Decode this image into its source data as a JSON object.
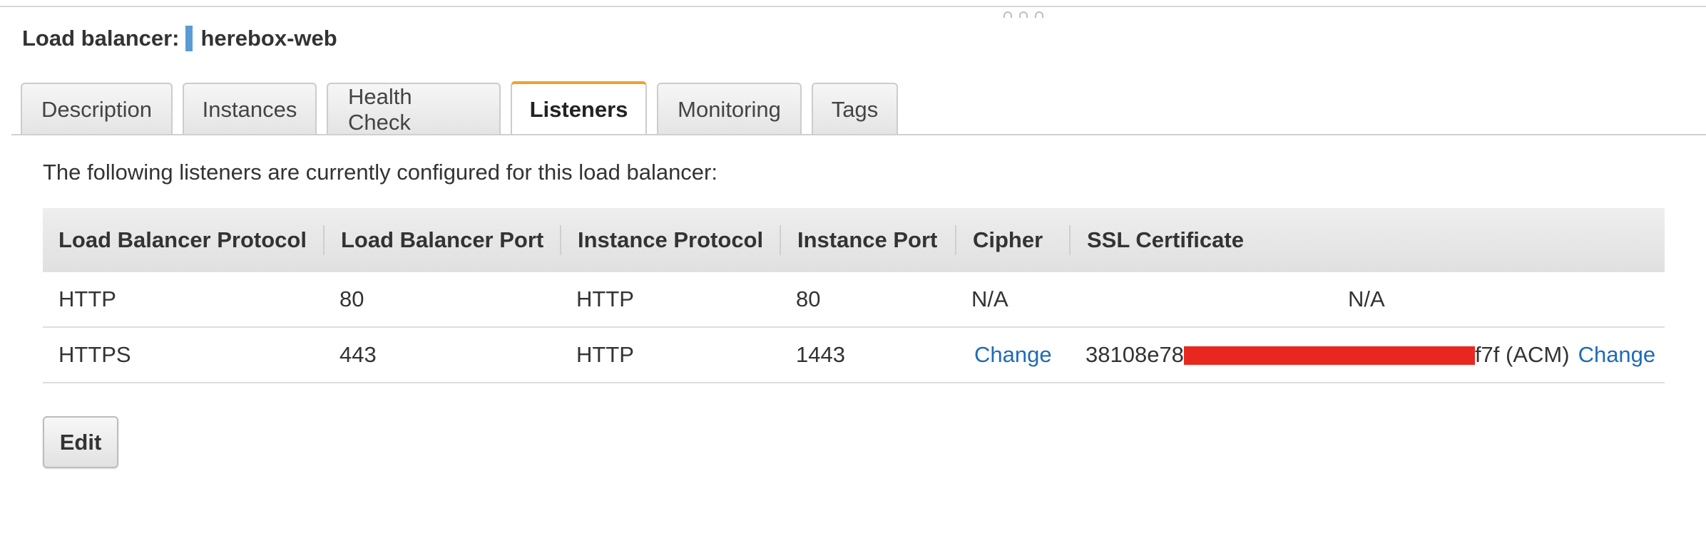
{
  "header": {
    "label": "Load balancer:",
    "name": "herebox-web"
  },
  "tabs": [
    {
      "label": "Description",
      "active": false
    },
    {
      "label": "Instances",
      "active": false
    },
    {
      "label": "Health Check",
      "active": false
    },
    {
      "label": "Listeners",
      "active": true
    },
    {
      "label": "Monitoring",
      "active": false
    },
    {
      "label": "Tags",
      "active": false
    }
  ],
  "intro_text": "The following listeners are currently configured for this load balancer:",
  "table": {
    "columns": [
      "Load Balancer Protocol",
      "Load Balancer Port",
      "Instance Protocol",
      "Instance Port",
      "Cipher",
      "SSL Certificate"
    ],
    "rows": [
      {
        "lb_protocol": "HTTP",
        "lb_port": "80",
        "instance_protocol": "HTTP",
        "instance_port": "80",
        "cipher": "N/A",
        "ssl_certificate": "N/A"
      },
      {
        "lb_protocol": "HTTPS",
        "lb_port": "443",
        "instance_protocol": "HTTP",
        "instance_port": "1443",
        "cipher_link": "Change",
        "ssl_prefix": "38108e78",
        "ssl_suffix": "f7f (ACM)",
        "ssl_link": "Change"
      }
    ]
  },
  "actions": {
    "edit_label": "Edit"
  },
  "colors": {
    "active_tab_accent": "#f0a030",
    "link": "#1f6bb5",
    "name_marker": "#5b9bd5",
    "redaction": "#e8281e"
  }
}
